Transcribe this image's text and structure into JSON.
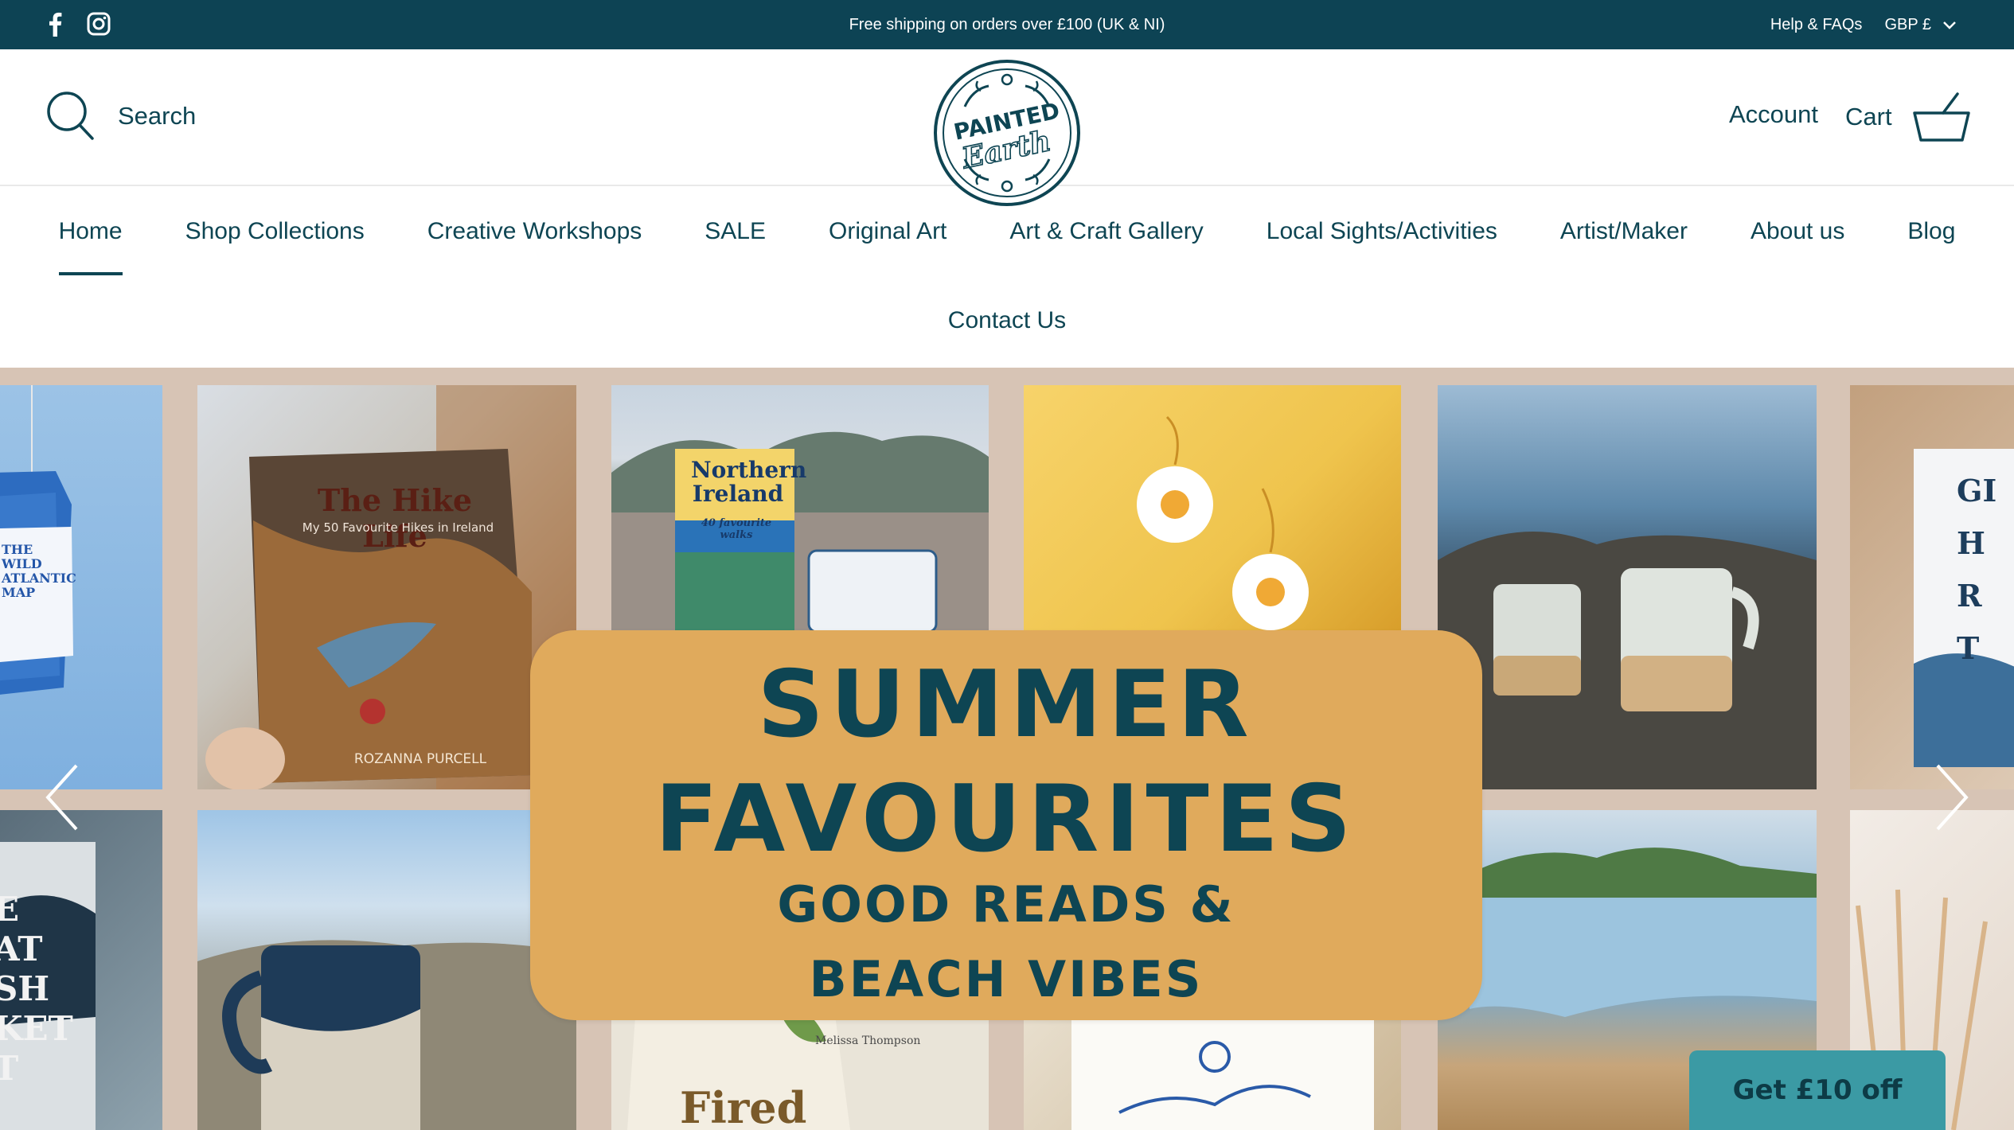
{
  "announcement": {
    "text": "Free shipping on orders over £100 (UK & NI)",
    "help_link": "Help & FAQs",
    "currency": "GBP £",
    "social": [
      "facebook-icon",
      "instagram-icon"
    ]
  },
  "header": {
    "search_label": "Search",
    "logo_line1": "PAINTED",
    "logo_line2": "Earth",
    "account_label": "Account",
    "cart_label": "Cart"
  },
  "nav": {
    "row1": [
      "Home",
      "Shop Collections",
      "Creative Workshops",
      "SALE",
      "Original Art",
      "Art & Craft Gallery",
      "Local Sights/Activities",
      "Artist/Maker",
      "About us",
      "Blog"
    ],
    "row2": [
      "Contact Us"
    ],
    "active": "Home"
  },
  "hero": {
    "title_line1": "SUMMER",
    "title_line2": "FAVOURITES",
    "subtitle_line1": "GOOD READS &",
    "subtitle_line2": "BEACH VIBES",
    "book1_title": "The Hike Life",
    "book1_subtitle": "My 50 Favourite Hikes in Ireland",
    "book1_author": "ROZANNA PURCELL",
    "book2_title": "Northern Ireland",
    "book2_subtitle": "40 favourite walks",
    "bag_text": "THE WILD ATLANTIC MAP",
    "left_book_text": "E AT SH KET T",
    "right_book_text": "GI H R T",
    "book3_author": "Melissa Thompson",
    "book3_title": "Fired Up"
  },
  "promo": {
    "label": "Get £10 off"
  },
  "colors": {
    "brand": "#0d4354",
    "banner": "#e0aa5c",
    "promo": "#3b9aa4",
    "hero_bg": "#d7c4b5"
  }
}
